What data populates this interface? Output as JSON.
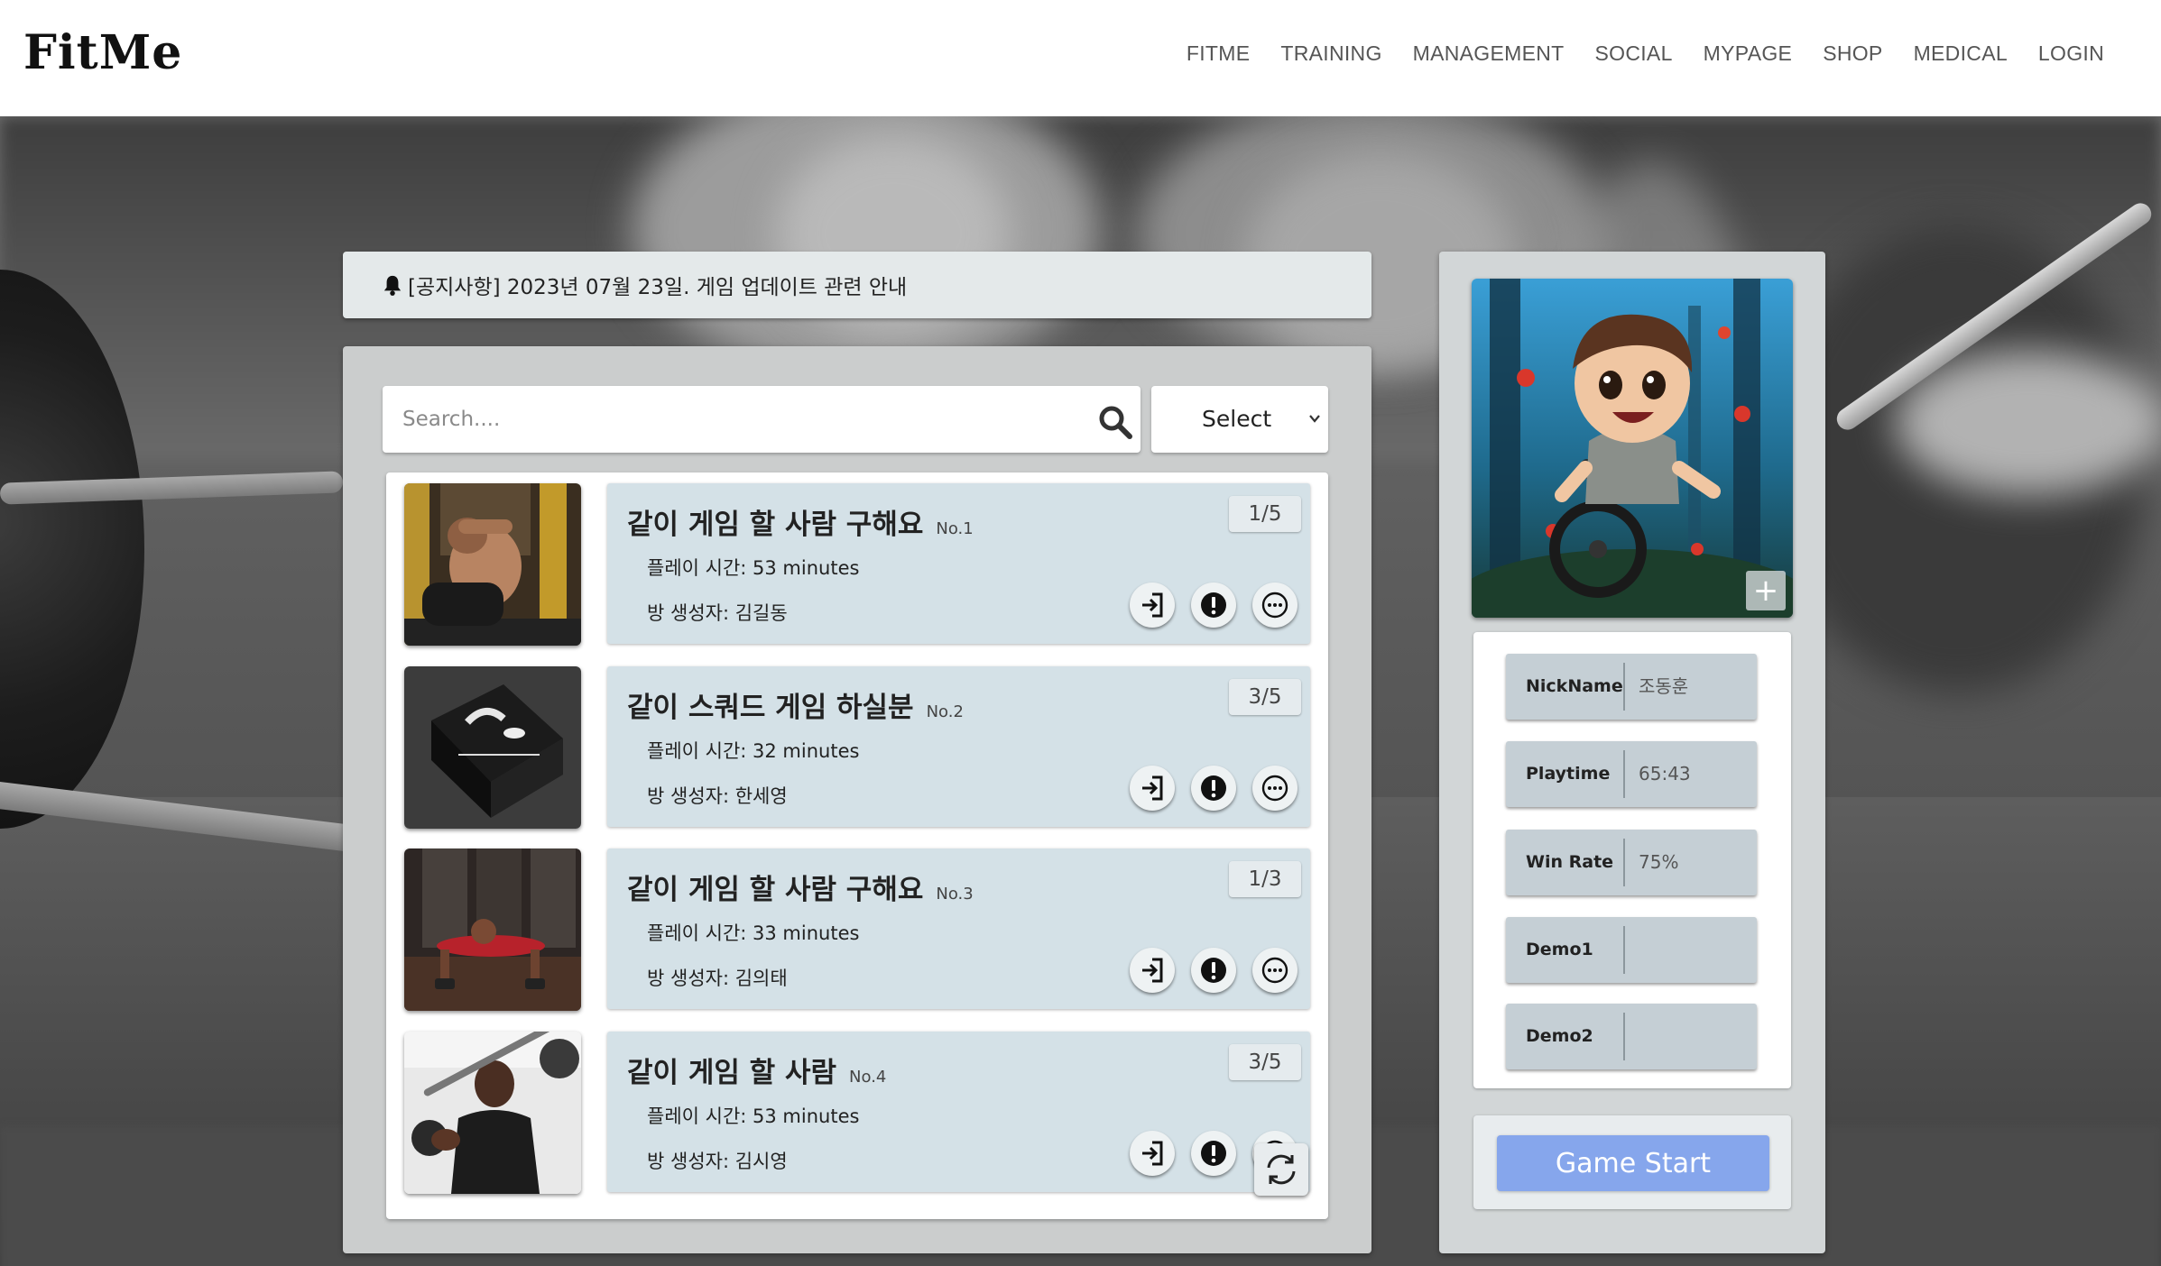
{
  "header": {
    "brand": "FitMe",
    "nav": [
      "FITME",
      "TRAINING",
      "MANAGEMENT",
      "SOCIAL",
      "MYPAGE",
      "SHOP",
      "MEDICAL",
      "LOGIN"
    ]
  },
  "notice": {
    "icon": "bell-icon",
    "text": "[공지사항] 2023년 07월 23일. 게임 업데이트 관련 안내"
  },
  "search": {
    "placeholder": "Search....",
    "icon": "search-icon"
  },
  "filter": {
    "selected": "Select",
    "icon": "chevron-down-icon"
  },
  "rooms": [
    {
      "title": "같이 게임 할 사람 구해요",
      "no": "No.1",
      "count": "1/5",
      "playtime": "플레이 시간: 53 minutes",
      "host": "방 생성자: 김길동",
      "thumb": "sit-up-athlete-photo"
    },
    {
      "title": "같이 스쿼드 게임 하실분",
      "no": "No.2",
      "count": "3/5",
      "playtime": "플레이 시간: 32 minutes",
      "host": "방 생성자: 한세영",
      "thumb": "black-box-photo"
    },
    {
      "title": "같이 게임 할 사람 구해요",
      "no": "No.3",
      "count": "1/3",
      "playtime": "플레이 시간: 33 minutes",
      "host": "방 생성자: 김의태",
      "thumb": "push-up-athlete-photo"
    },
    {
      "title": "같이 게임 할 사람",
      "no": "No.4",
      "count": "3/5",
      "playtime": "플레이 시간: 53 minutes",
      "host": "방 생성자: 김시영",
      "thumb": "barbell-athlete-photo"
    }
  ],
  "room_actions": {
    "enter_icon": "enter-icon",
    "report_icon": "alert-icon",
    "more_icon": "more-icon"
  },
  "refresh_icon": "refresh-icon",
  "profile": {
    "add_label": "+",
    "stats": [
      {
        "label": "NickName",
        "value": "조동훈"
      },
      {
        "label": "Playtime",
        "value": "65:43"
      },
      {
        "label": "Win Rate",
        "value": "75%"
      },
      {
        "label": "Demo1",
        "value": ""
      },
      {
        "label": "Demo2",
        "value": ""
      }
    ],
    "start_label": "Game Start"
  },
  "colors": {
    "card_bg": "#d4e1e7",
    "stat_bg": "#c5cfd5",
    "start_button": "#86a6ec",
    "panel_bg": "#cbcdcd"
  }
}
